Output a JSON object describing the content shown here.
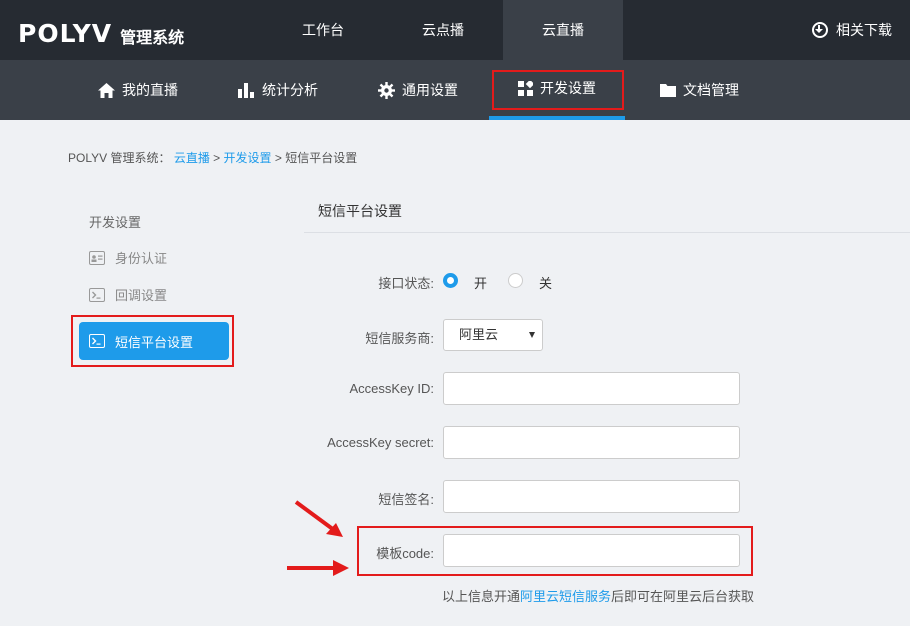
{
  "header": {
    "brand": "POLYV",
    "brand_sub": "管理系统",
    "tabs": [
      {
        "label": "工作台",
        "active": false
      },
      {
        "label": "云点播",
        "active": false
      },
      {
        "label": "云直播",
        "active": true
      }
    ],
    "download_label": "相关下载"
  },
  "subnav": {
    "tabs": [
      {
        "label": "我的直播",
        "icon": "home-icon"
      },
      {
        "label": "统计分析",
        "icon": "bar-chart-icon"
      },
      {
        "label": "通用设置",
        "icon": "gear-icon"
      },
      {
        "label": "开发设置",
        "icon": "grid-icon",
        "active": true
      },
      {
        "label": "文档管理",
        "icon": "folder-icon"
      }
    ]
  },
  "breadcrumb": {
    "root": "POLYV 管理系统：",
    "l1": "云直播",
    "sep": ">",
    "l2": "开发设置",
    "current": "短信平台设置"
  },
  "sidebar": {
    "title": "开发设置",
    "items": [
      {
        "label": "身份认证",
        "icon": "id-card-icon"
      },
      {
        "label": "回调设置",
        "icon": "terminal-icon"
      },
      {
        "label": "短信平台设置",
        "icon": "terminal-icon",
        "active": true
      }
    ]
  },
  "panel": {
    "title": "短信平台设置",
    "status_label": "接口状态:",
    "status_on": "开",
    "status_off": "关",
    "provider_label": "短信服务商:",
    "provider_value": "阿里云",
    "accesskey_id_label": "AccessKey ID:",
    "accesskey_secret_label": "AccessKey secret:",
    "signature_label": "短信签名:",
    "template_label": "模板code:",
    "hint_prefix": "以上信息开通",
    "hint_link": "阿里云短信服务",
    "hint_suffix": "后即可在阿里云后台获取"
  },
  "colors": {
    "accent": "#1e9bea",
    "highlight": "#e31b1b",
    "topbar": "#262b32",
    "subnav": "#3a4048"
  }
}
